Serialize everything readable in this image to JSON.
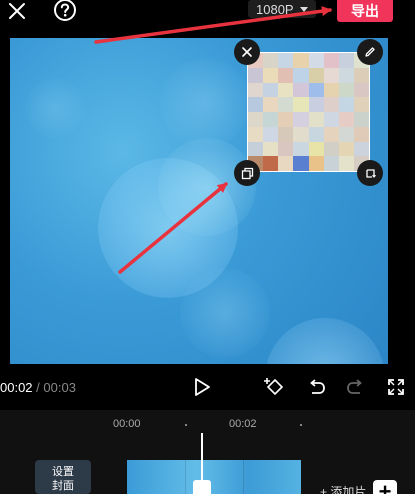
{
  "topbar": {
    "resolution": "1080P",
    "export_label": "导出"
  },
  "sticker": {
    "colors": [
      "#e8c9c0",
      "#d9d4c8",
      "#c7d6e4",
      "#e7d2ac",
      "#d2dbe6",
      "#e3c1c9",
      "#c8d0de",
      "#dfe2cf",
      "#c9c5d4",
      "#eadcb8",
      "#e1bfb2",
      "#bfd3e8",
      "#d8cfa8",
      "#e6d8d2",
      "#cdd9df",
      "#dccdb8",
      "#e0d6d0",
      "#c5d2e2",
      "#e8e1c2",
      "#d2c6d8",
      "#9fbdea",
      "#e5d3b0",
      "#cdd8c8",
      "#d8c7c2",
      "#b6c9df",
      "#e9d7bf",
      "#d3dbd0",
      "#e7e6b8",
      "#c9cfe0",
      "#decfcb",
      "#c4d6e3",
      "#e0d2ba",
      "#ddd7c9",
      "#c6d6d4",
      "#e4cfb6",
      "#d5d0df",
      "#e2e0c8",
      "#cfd8e2",
      "#e5ccc4",
      "#cbd2cc",
      "#e7dcc3",
      "#d0d7e4",
      "#d7c9b9",
      "#e2dccd",
      "#c8d6df",
      "#e6d3bd",
      "#d4d8d4",
      "#e0cbb9",
      "#c5cfd9",
      "#e5e0c6",
      "#d9c6c0",
      "#cad7e0",
      "#e8e4a8",
      "#d2cfc6",
      "#e4d6b4",
      "#ccd3dd",
      "#b98a6a",
      "#c06a4a",
      "#e8d8c2",
      "#5a7fd0",
      "#e9c28a",
      "#c9d2d6",
      "#e5e2cc",
      "#d5ccc4"
    ]
  },
  "controls": {
    "current_time": "00:02",
    "separator": "/",
    "total_time": "00:03"
  },
  "timeline": {
    "ruler": [
      "00:00",
      "00:02"
    ],
    "cover_label": "设置\n封面",
    "add_clip_label": "+ 添加片",
    "add_button": "+"
  },
  "colors": {
    "accent": "#f0345a",
    "annotation_arrow": "#e8333e"
  }
}
